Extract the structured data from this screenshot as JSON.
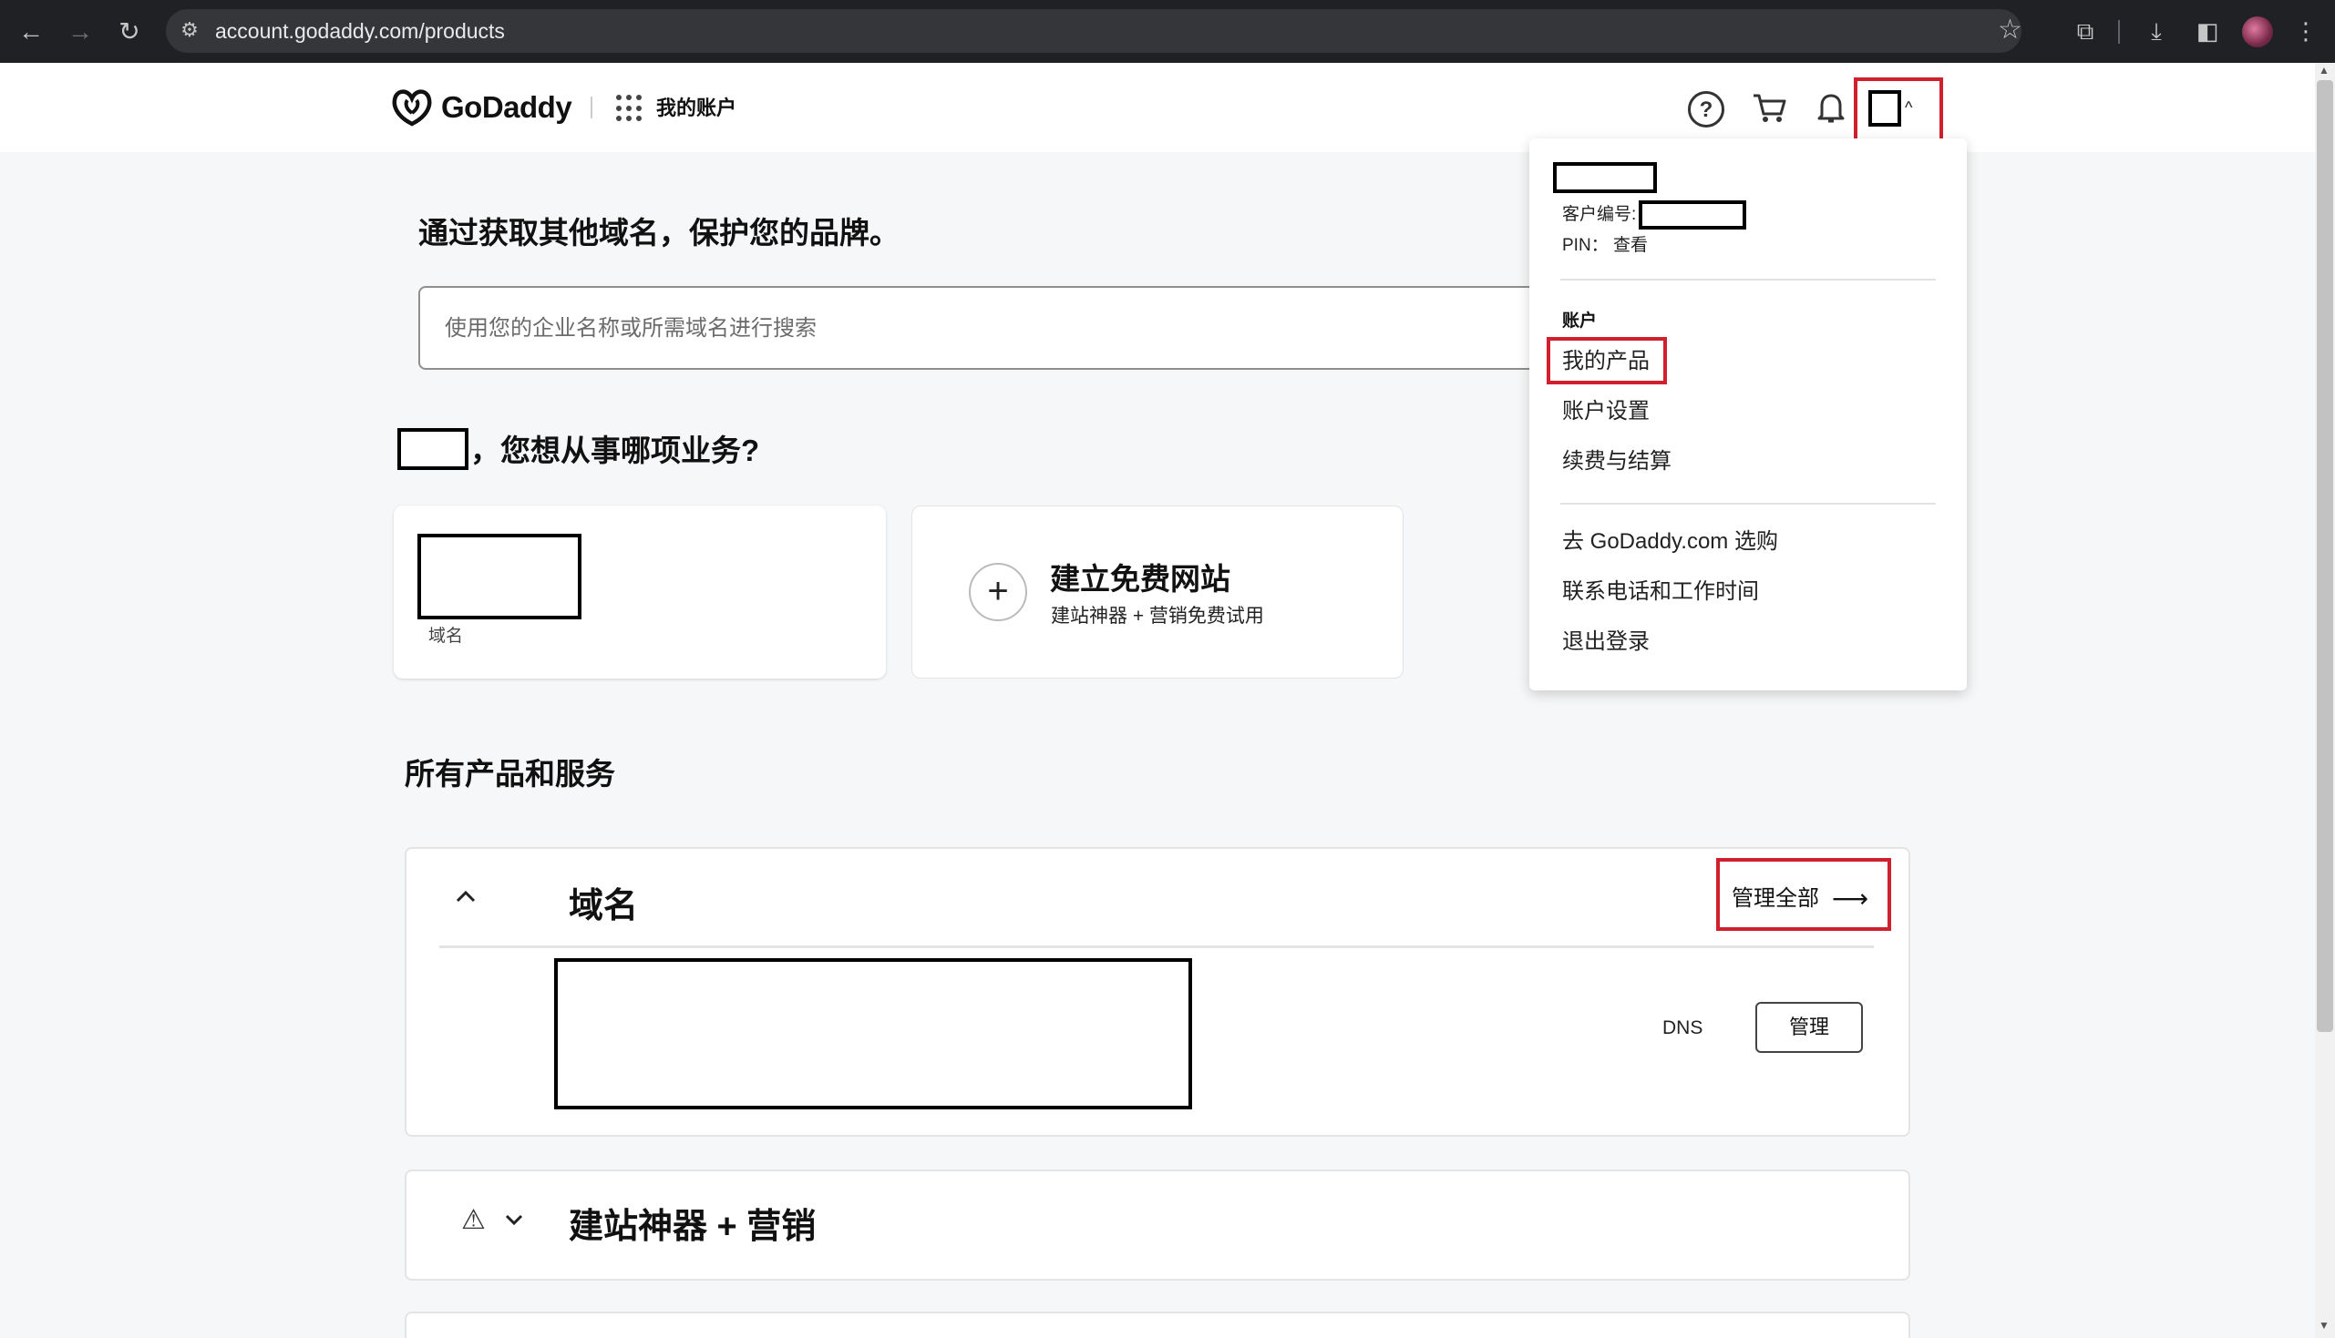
{
  "browser": {
    "url": "account.godaddy.com/products",
    "back_icon": "←",
    "forward_icon": "→",
    "reload_icon": "↻"
  },
  "header": {
    "logo_text": "GoDaddy",
    "my_account": "我的账户"
  },
  "main": {
    "promo_title": "通过获取其他域名，保护您的品牌。",
    "search_placeholder": "使用您的企业名称或所需域名进行搜索",
    "greeting": "，您想从事哪项业务?",
    "cards": {
      "domain_label": "域名",
      "site_title": "建立免费网站",
      "site_subtitle": "建站神器 + 营销免费试用"
    },
    "all_products_title": "所有产品和服务",
    "domain_panel": {
      "heading": "域名",
      "manage_all": "管理全部",
      "dns_label": "DNS",
      "manage_button": "管理"
    },
    "site_panel": {
      "heading": "建站神器 + 营销"
    }
  },
  "dropdown": {
    "customer_label": "客户编号:",
    "pin_label": "PIN：",
    "pin_link": "查看",
    "section_title": "账户",
    "items": [
      "我的产品",
      "账户设置",
      "续费与结算"
    ],
    "links": [
      "去 GoDaddy.com 选购",
      "联系电话和工作时间",
      "退出登录"
    ]
  },
  "colors": {
    "highlight": "#d0202e",
    "chrome_bg": "#202124",
    "page_bg": "#f5f7f8"
  }
}
